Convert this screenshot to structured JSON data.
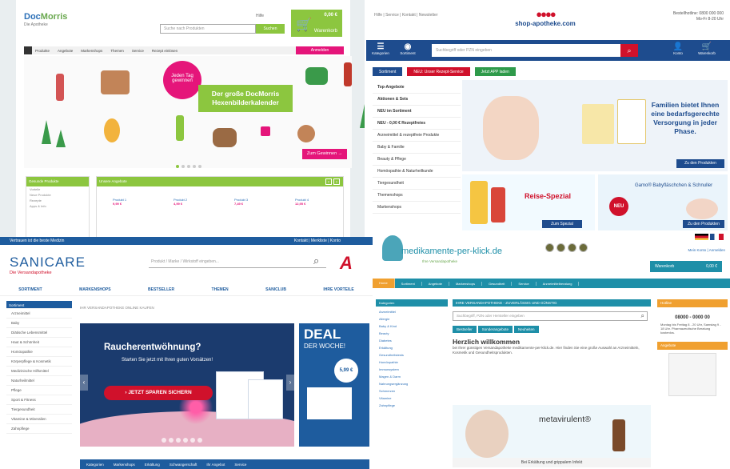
{
  "docmorris": {
    "logo_a": "Doc",
    "logo_b": "Morris",
    "tagline": "Die Apotheke",
    "header_link": "Hilfe",
    "search_placeholder": "Suche nach Produkten",
    "search_button": "Suchen",
    "cart_amount": "0,00 €",
    "cart_label": "Warenkorb",
    "nav_items": [
      "Produkte",
      "Angebote",
      "Markenshops",
      "Themen",
      "Service",
      "Rezept einlösen"
    ],
    "nav_button": "Anmelden",
    "badge": "Jeden Tag gewinnen",
    "banner": "Der große DocMorris Hexenbilderkalender",
    "cta": "Zum Gewinnen →",
    "box1_title": "Gesunde Produkte",
    "box1_rows": [
      "Vorteile",
      "Neue Produkte",
      "Rezepte",
      "Apps & Info"
    ],
    "box2_title": "Unsere Angebote",
    "products": [
      {
        "name": "Produkt 1",
        "price": "9,99 €"
      },
      {
        "name": "Produkt 2",
        "price": "4,99 €"
      },
      {
        "name": "Produkt 3",
        "price": "7,49 €"
      },
      {
        "name": "Produkt 4",
        "price": "12,95 €"
      }
    ]
  },
  "shopapotheke": {
    "breadcrumb": "Hilfe | Service | Kontakt | Newsletter",
    "logo": "shop-apotheke.com",
    "contact_line1": "Bestellhotline: 0800 000 000",
    "contact_line2": "Mo-Fr 8-20 Uhr",
    "nav_icons": [
      "Kategorien",
      "Sortiment",
      "Konto",
      "Warenkorb"
    ],
    "search_placeholder": "Suchbegriff oder PZN eingeben",
    "pills": [
      "Sortiment",
      "NEU: Unser Rezept-Service",
      "Jetzt APP laden"
    ],
    "left_menu": [
      "Top-Angebote",
      "Aktionen & Sets",
      "NEU im Sortiment",
      "NEU - 0,00 € Rezeptfreies",
      "Arzneimittel & rezeptfreie Produkte",
      "Baby & Familie",
      "Beauty & Pflege",
      "Homöopathie & Naturheilkunde",
      "Tiergesundheit",
      "Themenshops",
      "Markenshops"
    ],
    "banner1_text": "Familien bietet Ihnen eine bedarfsgerechte Versorgung in jeder Phase.",
    "banner1_button": "Zu den Produkten",
    "banner2_text": "Reise-Spezial",
    "banner2_button": "Zum Spezial",
    "banner3_text": "Gamo® Babyfläschchen & Schnuller",
    "banner3_badge": "NEU",
    "banner3_button": "Zu den Produkten"
  },
  "sanicare": {
    "topbar": "Vertrauen ist die beste Medizin",
    "topbar_right": "Kontakt  |  Merkliste  |  Konto",
    "logo": "SANICARE",
    "tagline": "Die Versandapotheke",
    "search_placeholder": "Produkt / Marke / Wirkstoff eingeben...",
    "brand_mark": "A",
    "nav": [
      "SORTIMENT",
      "MARKENSHOPS",
      "BESTSELLER",
      "THEMEN",
      "SANICLUB",
      "IHRE VORTEILE"
    ],
    "left_title": "Sortiment",
    "left_items": [
      "Arzneimittel",
      "Baby",
      "Diätische Lebensmittel",
      "Haut & Schönheit",
      "Homöopathie",
      "Körperpflege & Kosmetik",
      "Medizinische Hilfsmittel",
      "Naturheilmittel",
      "Pflege",
      "Sport & Fitness",
      "Tiergesundheit",
      "Vitamine & Mineralien",
      "Zahnpflege"
    ],
    "breadcrumb": "IHR VERSANDAPOTHEKE ONLINE KAUFEN",
    "hero_title": "Raucherentwöhnung?",
    "hero_sub": "Starten Sie jetzt mit Ihren guten Vorsätzen!",
    "hero_cta": "› JETZT SPAREN SICHERN",
    "deal_title": "DEAL",
    "deal_sub": "DER WOCHE!",
    "deal_price": "5,99 €",
    "bottom_links": [
      "Kategorien",
      "Markenshops",
      "Erkältung",
      "Schwangerschaft",
      "Ihr Angebot",
      "Service"
    ]
  },
  "mediklick": {
    "logo": "medikamente-per-klick.de",
    "tagline": "Ihre Versandapotheke",
    "account": "Mein Konto  |  Anmelden",
    "cart_label": "Warenkorb",
    "cart_amount": "0,00 €",
    "nav": [
      "Home",
      "Sortiment",
      "Angebote",
      "Markenshops",
      "Gesundheit",
      "Service",
      "Arzneimittelberatung"
    ],
    "left_title": "Kategorien",
    "left_items": [
      "Arzneimittel",
      "Allergie",
      "Baby & Kind",
      "Beauty",
      "Diabetes",
      "Erkältung",
      "Gesundheitstests",
      "Homöopathie",
      "Immunsystem",
      "Magen & Darm",
      "Nahrungsergänzung",
      "Schmerzen",
      "Vitamine",
      "Zahnpflege"
    ],
    "main_bar": "IHRE VERSANDAPOTHEKE - ZUVERLÄSSIG UND GÜNSTIG",
    "search_placeholder": "Suchbegriff, PZN oder Hersteller eingeben",
    "tabs": [
      "Bestseller",
      "Sonderangebote",
      "Neuheiten"
    ],
    "welcome_title": "Herzlich willkommen",
    "welcome_text": "bei Ihrer günstigen Versandapotheke medikamente-per-klick.de. Hier finden Sie eine große Auswahl an Arzneimitteln, Kosmetik und Gesundheitsprodukten.",
    "ad_brand": "metavirulent®",
    "ad_footer": "Bei Erkältung und grippalem Infekt",
    "right_title": "Hotline",
    "hotline": "08000 - 0000 00",
    "right_text": "Montag bis Freitag 8 - 20 Uhr, Samstag 9 - 18 Uhr. Pharmazeutische Beratung kostenlos.",
    "right_title2": "Angebote"
  }
}
